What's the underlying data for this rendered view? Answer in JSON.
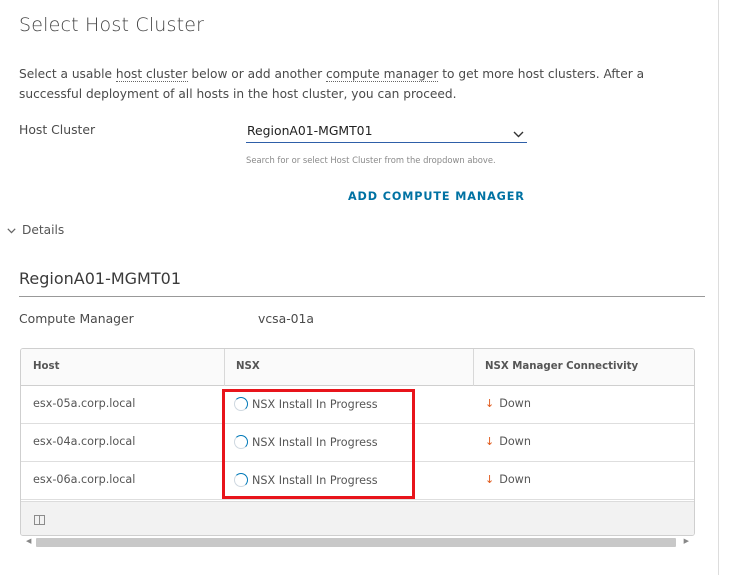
{
  "page": {
    "title": "Select Host Cluster",
    "intro": {
      "part1": "Select a usable ",
      "link1": "host cluster",
      "part2": " below or add another ",
      "link2": "compute manager",
      "part3": " to get more host clusters. After a successful deployment of all hosts in the host cluster, you can proceed."
    }
  },
  "form": {
    "host_cluster_label": "Host Cluster",
    "host_cluster_value": "RegionA01-MGMT01",
    "helper_text": "Search for or select Host Cluster from the dropdown above.",
    "add_compute_manager": "ADD COMPUTE MANAGER"
  },
  "details": {
    "toggle_label": "Details",
    "cluster_name": "RegionA01-MGMT01",
    "compute_manager_label": "Compute Manager",
    "compute_manager_value": "vcsa-01a"
  },
  "grid": {
    "columns": [
      "Host",
      "NSX",
      "NSX Manager Connectivity"
    ],
    "rows": [
      {
        "host": "esx-05a.corp.local",
        "nsx": "NSX Install In Progress",
        "connectivity": "Down"
      },
      {
        "host": "esx-04a.corp.local",
        "nsx": "NSX Install In Progress",
        "connectivity": "Down"
      },
      {
        "host": "esx-06a.corp.local",
        "nsx": "NSX Install In Progress",
        "connectivity": "Down"
      }
    ]
  },
  "colors": {
    "link": "#0072a3",
    "down_arrow": "#e05a1c",
    "highlight": "#e8141b",
    "spinner": "#0079b8"
  },
  "icons": {
    "dropdown": "chevron-down-icon",
    "details": "chevron-down-icon",
    "status_progress": "spinner-icon",
    "status_down": "arrow-down-icon",
    "column_toggle": "column-toggle-icon"
  }
}
